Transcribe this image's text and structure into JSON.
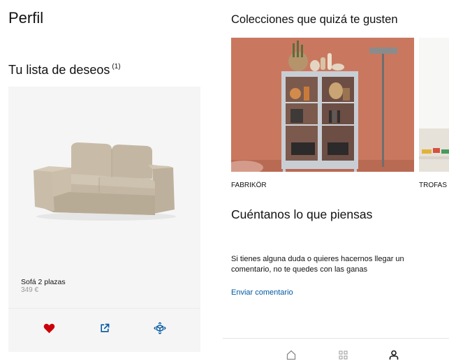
{
  "profile": {
    "title": "Perfil"
  },
  "wishlist": {
    "title": "Tu lista de deseos",
    "count": "(1)",
    "product": {
      "name": "Sofá 2 plazas",
      "price": "349 €"
    },
    "actions": [
      "heart-icon",
      "share-icon",
      "view-3d-icon"
    ]
  },
  "collections": {
    "title": "Colecciones que quizá te gusten",
    "items": [
      {
        "label": "FABRIKÖR"
      },
      {
        "label": "TROFAS"
      }
    ]
  },
  "feedback": {
    "title": "Cuéntanos lo que piensas",
    "text": "Si tienes alguna duda o quieres hacernos llegar un comentario, no te quedes con las ganas",
    "link": "Enviar comentario"
  },
  "bottom_nav": {
    "items": [
      "home-icon",
      "grid-icon",
      "profile-icon"
    ],
    "active": "profile-icon"
  },
  "colors": {
    "link": "#0058a3",
    "heart": "#cc0008",
    "card_bg": "#f5f5f5",
    "wall": "#c9785f"
  }
}
